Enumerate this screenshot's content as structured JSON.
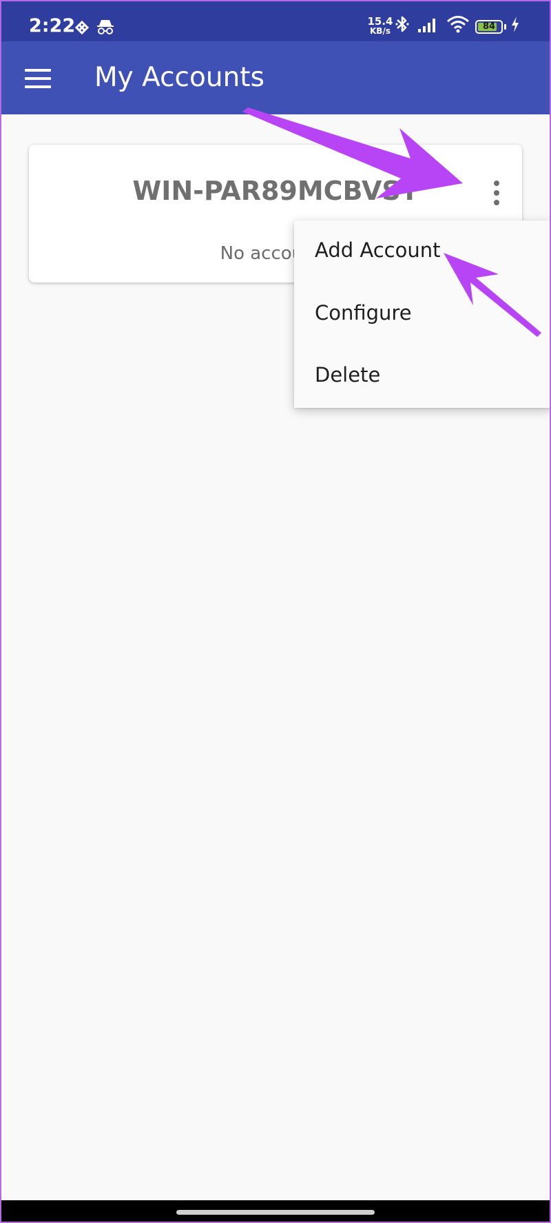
{
  "status_bar": {
    "time": "2:22",
    "left_icons": [
      "vpn-key-icon",
      "incognito-icon"
    ],
    "net_speed_value": "15.4",
    "net_speed_unit": "KB/s",
    "right_icons": [
      "bluetooth-icon",
      "signal-icon",
      "wifi-icon",
      "battery-icon",
      "charging-icon"
    ],
    "battery_level": "84",
    "battery_fraction": 0.84
  },
  "app_bar": {
    "menu_icon": "hamburger-menu-icon",
    "title": "My Accounts",
    "color": "#3f51b5"
  },
  "card": {
    "title": "WIN-PAR89MCBVST",
    "empty_text": "No accounts",
    "overflow_icon": "more-vert-icon"
  },
  "popup_menu": {
    "items": [
      {
        "label": "Add Account"
      },
      {
        "label": "Configure"
      },
      {
        "label": "Delete"
      }
    ]
  },
  "annotation_color": "#b845f5"
}
